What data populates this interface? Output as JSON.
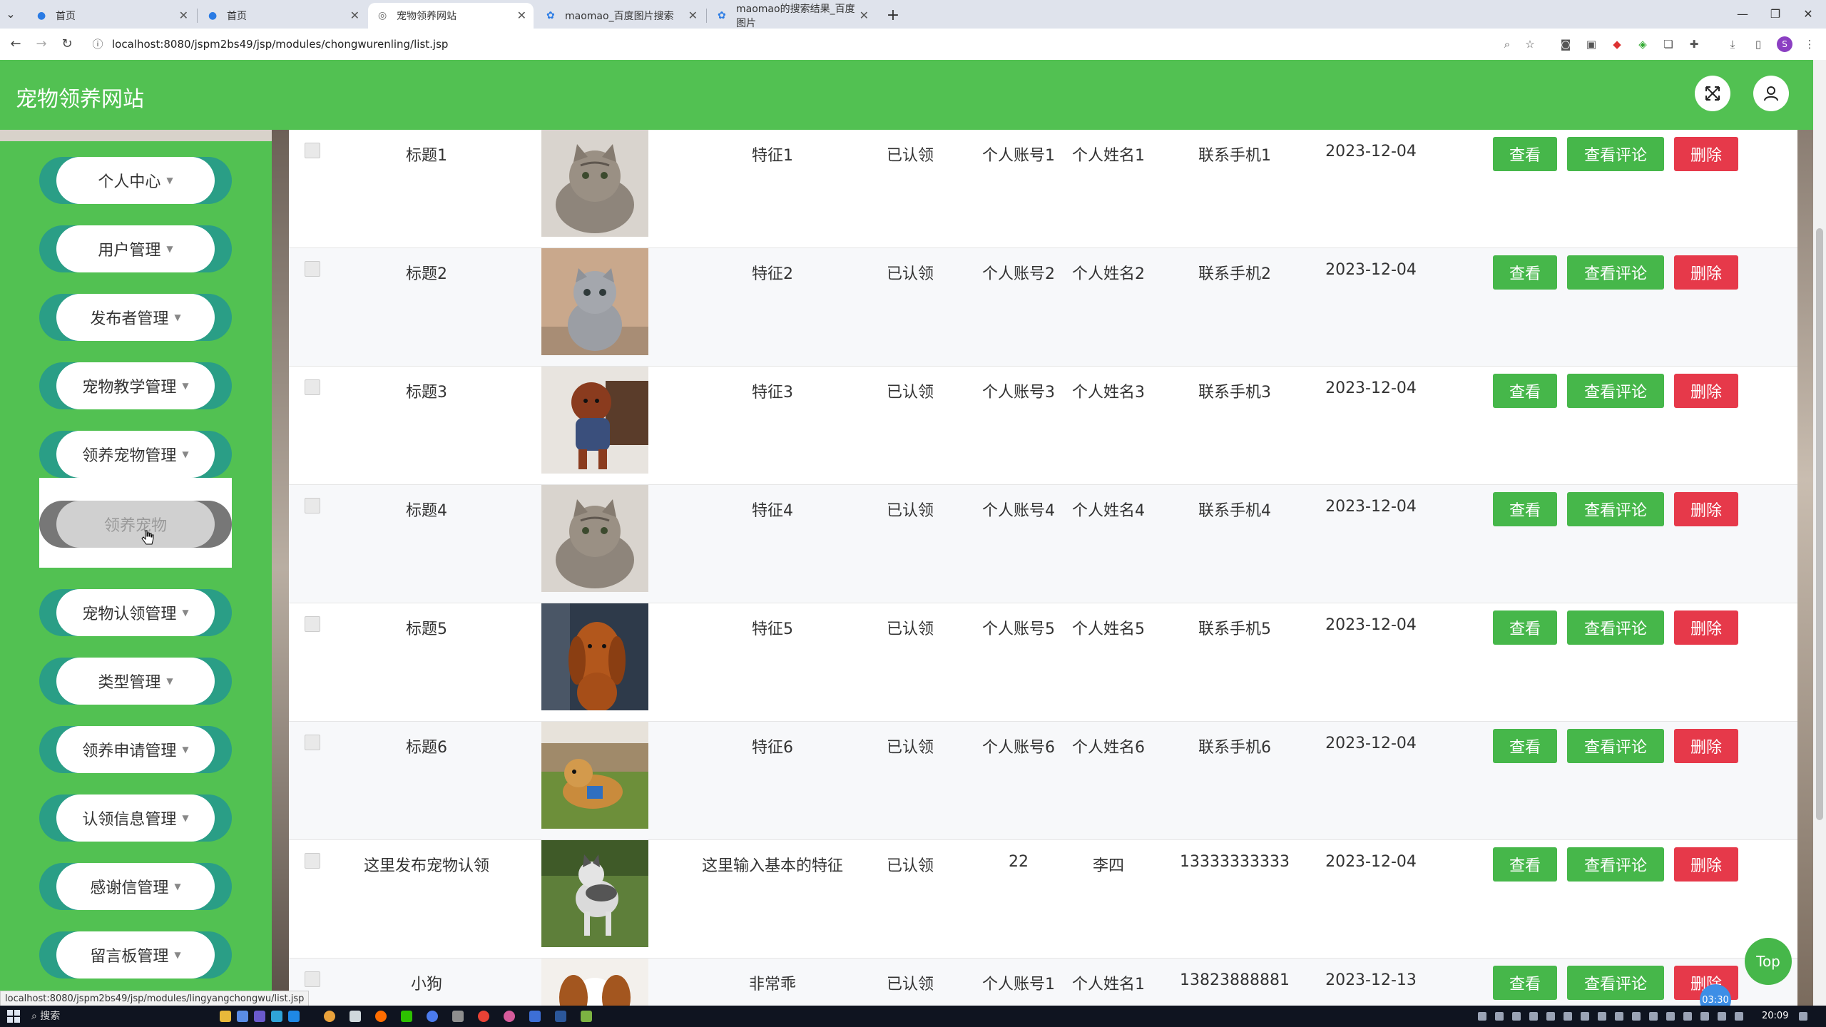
{
  "browser": {
    "tabs": [
      {
        "title": "首页"
      },
      {
        "title": "首页"
      },
      {
        "title": "宠物领养网站"
      },
      {
        "title": "maomao_百度图片搜索"
      },
      {
        "title": "maomao的搜索结果_百度图片"
      }
    ],
    "url": "localhost:8080/jspm2bs49/jsp/modules/chongwurenling/list.jsp",
    "new_tab": "+",
    "profile_initial": "S"
  },
  "app": {
    "title": "宠物领养网站",
    "accent": "#52c152"
  },
  "sidebar": {
    "items": [
      {
        "label": "个人中心"
      },
      {
        "label": "用户管理"
      },
      {
        "label": "发布者管理"
      },
      {
        "label": "宠物教学管理"
      },
      {
        "label": "领养宠物管理"
      },
      {
        "label": "宠物认领管理"
      },
      {
        "label": "类型管理"
      },
      {
        "label": "领养申请管理"
      },
      {
        "label": "认领信息管理"
      },
      {
        "label": "感谢信管理"
      },
      {
        "label": "留言板管理"
      }
    ],
    "submenu_item": "领养宠物"
  },
  "table": {
    "rows": [
      {
        "title": "标题1",
        "feature": "特征1",
        "status": "已认领",
        "account": "个人账号1",
        "name": "个人姓名1",
        "phone": "联系手机1",
        "date": "2023-12-04",
        "image": "cat-tabby"
      },
      {
        "title": "标题2",
        "feature": "特征2",
        "status": "已认领",
        "account": "个人账号2",
        "name": "个人姓名2",
        "phone": "联系手机2",
        "date": "2023-12-04",
        "image": "cat-grey"
      },
      {
        "title": "标题3",
        "feature": "特征3",
        "status": "已认领",
        "account": "个人账号3",
        "name": "个人姓名3",
        "phone": "联系手机3",
        "date": "2023-12-04",
        "image": "dog-poodle"
      },
      {
        "title": "标题4",
        "feature": "特征4",
        "status": "已认领",
        "account": "个人账号4",
        "name": "个人姓名4",
        "phone": "联系手机4",
        "date": "2023-12-04",
        "image": "cat-tabby"
      },
      {
        "title": "标题5",
        "feature": "特征5",
        "status": "已认领",
        "account": "个人账号5",
        "name": "个人姓名5",
        "phone": "联系手机5",
        "date": "2023-12-04",
        "image": "dog-brown"
      },
      {
        "title": "标题6",
        "feature": "特征6",
        "status": "已认领",
        "account": "个人账号6",
        "name": "个人姓名6",
        "phone": "联系手机6",
        "date": "2023-12-04",
        "image": "dog-golden"
      },
      {
        "title": "这里发布宠物认领",
        "feature": "这里输入基本的特征",
        "status": "已认领",
        "account": "22",
        "name": "李四",
        "phone": "13333333333",
        "date": "2023-12-04",
        "image": "dog-husky"
      },
      {
        "title": "小狗",
        "feature": "非常乖",
        "status": "已认领",
        "account": "个人账号1",
        "name": "个人姓名1",
        "phone": "13823888881",
        "date": "2023-12-13",
        "image": "dog-spaniel"
      }
    ],
    "actions": {
      "view": "查看",
      "comment": "查看评论",
      "delete": "删除"
    }
  },
  "top_button": "Top",
  "timer": "03:30",
  "status_url": "localhost:8080/jspm2bs49/jsp/modules/lingyangchongwu/list.jsp",
  "taskbar": {
    "search": "搜索",
    "time": "20:09"
  },
  "colors": {
    "green_button": "#46b74a",
    "delete_button": "#e6394a",
    "sidebar_accent": "#2a9e86"
  }
}
